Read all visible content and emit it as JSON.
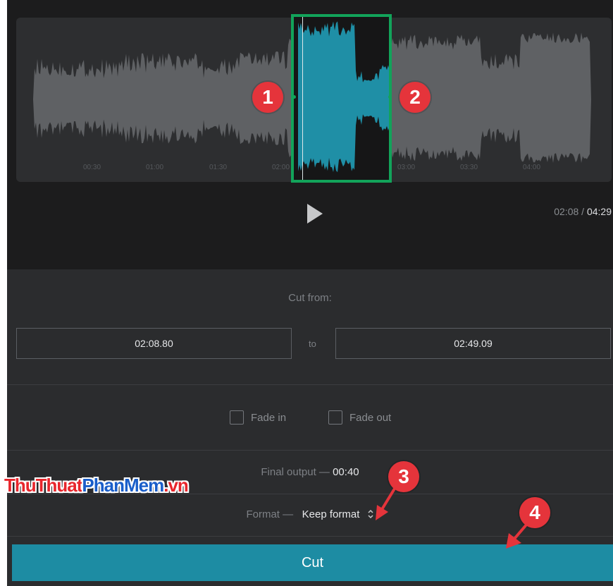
{
  "colors": {
    "selection_border": "#12a35a",
    "selected_waveform": "#1f8fa6",
    "waveform": "#5f6164",
    "cut_button": "#1d8ca3",
    "annotation_badge": "#e5343b"
  },
  "waveform": {
    "timeline_ticks": [
      "00:30",
      "01:00",
      "01:30",
      "02:00",
      "02:30",
      "03:00",
      "03:30",
      "04:00"
    ],
    "handles": {
      "start_badge": "1",
      "end_badge": "2"
    }
  },
  "player": {
    "play_icon": "play-icon",
    "current_time": "02:08",
    "separator": "/",
    "total_time": "04:29"
  },
  "cut": {
    "label": "Cut from:",
    "from": "02:08.80",
    "to_label": "to",
    "to": "02:49.09"
  },
  "fade": {
    "fade_in_label": "Fade in",
    "fade_in_checked": false,
    "fade_out_label": "Fade out",
    "fade_out_checked": false
  },
  "output": {
    "final_label": "Final output —",
    "final_value": "00:40",
    "format_label": "Format —",
    "format_value": "Keep format",
    "format_icon": "up-down-chevron-icon"
  },
  "cut_button": {
    "label": "Cut"
  },
  "annotations": {
    "badge_3": "3",
    "badge_4": "4"
  },
  "watermark": {
    "part1": "ThuThuat",
    "part2": "PhanMem",
    "part3": ".vn"
  }
}
